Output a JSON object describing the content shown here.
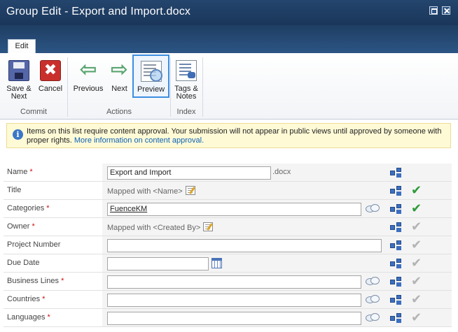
{
  "window": {
    "title": "Group Edit - Export and Import.docx"
  },
  "ribbon": {
    "tabs": [
      {
        "label": "Edit"
      }
    ],
    "groups": {
      "commit": {
        "label": "Commit",
        "save_line1": "Save &",
        "save_line2": "Next",
        "cancel": "Cancel"
      },
      "actions": {
        "label": "Actions",
        "previous": "Previous",
        "next": "Next",
        "preview": "Preview"
      },
      "index": {
        "label": "Index",
        "tags_line1": "Tags &",
        "tags_line2": "Notes"
      }
    }
  },
  "info": {
    "message": "Items on this list require content approval. Your submission will not appear in public views until approved by someone with proper rights.",
    "link": "More information on content approval."
  },
  "form": {
    "fields": [
      {
        "label": "Name",
        "required": "*",
        "value": "Export and Import",
        "suffix": ".docx",
        "status": "none"
      },
      {
        "label": "Title",
        "required": "",
        "mapped": "Mapped with <Name>",
        "status": "approved"
      },
      {
        "label": "Categories",
        "required": "*",
        "value": "FuenceKM",
        "status": "approved"
      },
      {
        "label": "Owner",
        "required": "*",
        "mapped": "Mapped with <Created By>",
        "status": "pending"
      },
      {
        "label": "Project Number",
        "required": "",
        "value": "",
        "status": "pending"
      },
      {
        "label": "Due Date",
        "required": "",
        "value": "",
        "status": "pending"
      },
      {
        "label": "Business Lines",
        "required": "*",
        "value": "",
        "status": "pending"
      },
      {
        "label": "Countries",
        "required": "*",
        "value": "",
        "status": "pending"
      },
      {
        "label": "Languages",
        "required": "*",
        "value": "",
        "status": "pending"
      }
    ]
  },
  "icons": {
    "check": "✔",
    "info": "i",
    "cancel": "✖",
    "arrow_left": "⇦",
    "arrow_right": "⇨"
  },
  "colors": {
    "titlebar": "#1f3e63",
    "approved": "#2e9a3a",
    "pending": "#b4b4b4",
    "required": "#cc1111",
    "link": "#0b61b6"
  }
}
